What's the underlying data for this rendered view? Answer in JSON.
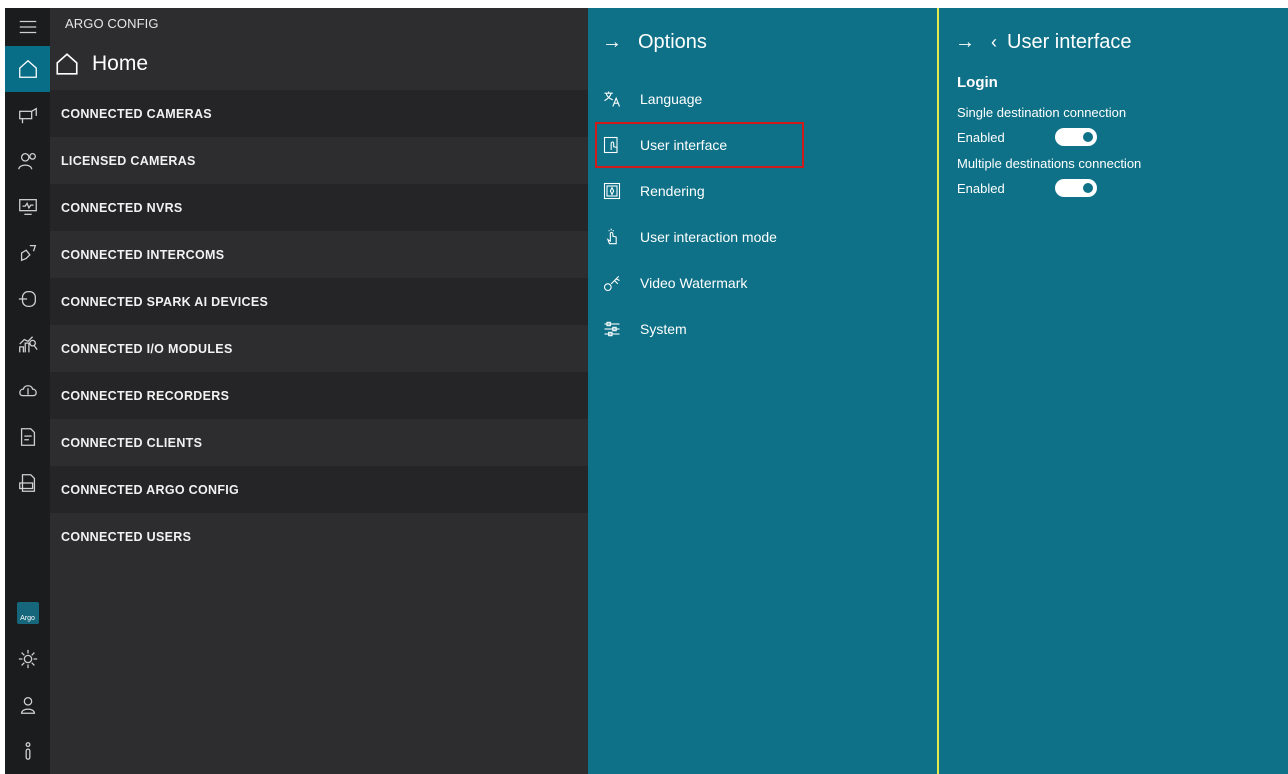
{
  "app": {
    "title": "ARGO CONFIG"
  },
  "rail": {
    "items": [
      {
        "icon": "hamburger-menu-icon"
      },
      {
        "icon": "home-icon",
        "active": true
      },
      {
        "icon": "camera-icon"
      },
      {
        "icon": "users-icon"
      },
      {
        "icon": "nvr-monitor-icon"
      },
      {
        "icon": "intercom-icon"
      },
      {
        "icon": "spark-device-icon"
      },
      {
        "icon": "io-module-chart-icon"
      },
      {
        "icon": "cloud-recorder-icon"
      },
      {
        "icon": "client-document-icon"
      },
      {
        "icon": "log-file-icon"
      }
    ],
    "bottom": [
      {
        "icon": "argo-logo-icon",
        "label": "Argo"
      },
      {
        "icon": "gear-icon"
      },
      {
        "icon": "user-icon"
      },
      {
        "icon": "info-icon"
      }
    ]
  },
  "main": {
    "home_title": "Home",
    "items": [
      "CONNECTED CAMERAS",
      "LICENSED CAMERAS",
      "CONNECTED NVRS",
      "CONNECTED INTERCOMS",
      "CONNECTED SPARK AI DEVICES",
      "CONNECTED I/O MODULES",
      "CONNECTED RECORDERS",
      "CONNECTED CLIENTS",
      "CONNECTED ARGO CONFIG",
      "CONNECTED USERS"
    ]
  },
  "options": {
    "title": "Options",
    "items": [
      {
        "label": "Language",
        "icon": "translate-icon"
      },
      {
        "label": "User interface",
        "icon": "touch-screen-icon",
        "selected": true
      },
      {
        "label": "Rendering",
        "icon": "rendering-icon"
      },
      {
        "label": "User interaction mode",
        "icon": "tap-hand-icon"
      },
      {
        "label": "Video Watermark",
        "icon": "watermark-icon"
      },
      {
        "label": "System",
        "icon": "sliders-icon"
      }
    ]
  },
  "detail": {
    "title": "User interface",
    "section": "Login",
    "settings": [
      {
        "label": "Single destination connection",
        "state": "Enabled",
        "on": true
      },
      {
        "label": "Multiple destinations connection",
        "state": "Enabled",
        "on": true
      }
    ]
  },
  "colors": {
    "rail_bg": "#1b1c1e",
    "main_bg": "#2d2d30",
    "panel_bg": "#0e7187",
    "active_rail": "#086e87",
    "selection_outline": "#d01b1b",
    "divider": "#e3eb4a"
  }
}
